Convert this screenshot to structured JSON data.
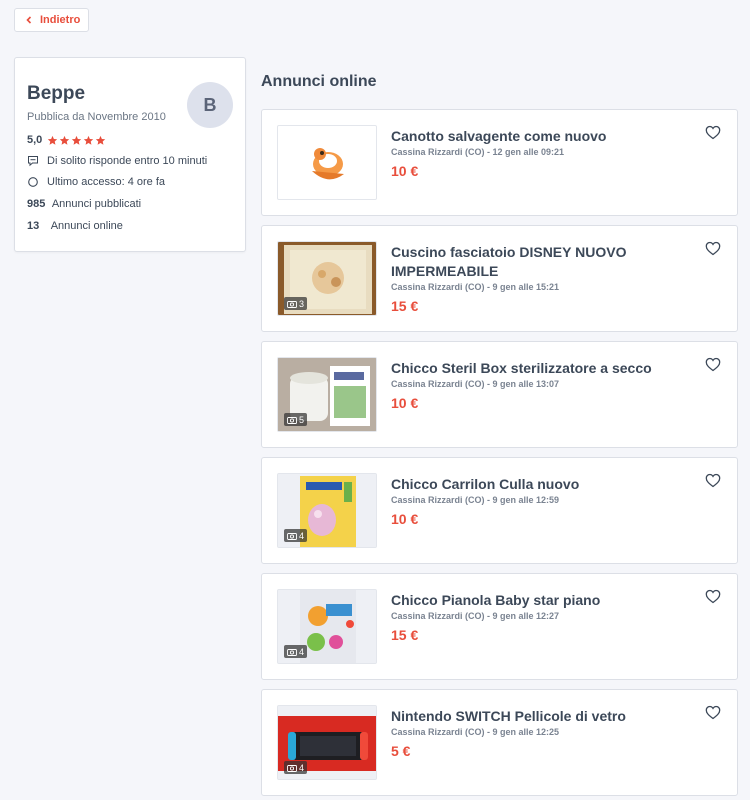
{
  "back": {
    "label": "Indietro"
  },
  "profile": {
    "name": "Beppe",
    "since": "Pubblica da Novembre 2010",
    "avatar_letter": "B",
    "rating": "5,0",
    "response": "Di solito risponde entro 10 minuti",
    "last_access": "Ultimo accesso: 4 ore fa",
    "published_count": "985",
    "published_label": "Annunci pubblicati",
    "online_count": "13",
    "online_label": "Annunci online"
  },
  "section_title": "Annunci online",
  "listings": [
    {
      "title": "Canotto salvagente come nuovo",
      "meta": "Cassina Rizzardi (CO) - 12 gen alle 09:21",
      "price": "10 €",
      "photos": ""
    },
    {
      "title": "Cuscino fasciatoio DISNEY NUOVO IMPERMEABILE",
      "meta": "Cassina Rizzardi (CO) - 9 gen alle 15:21",
      "price": "15 €",
      "photos": "3"
    },
    {
      "title": "Chicco Steril Box sterilizzatore a secco",
      "meta": "Cassina Rizzardi (CO) - 9 gen alle 13:07",
      "price": "10 €",
      "photos": "5"
    },
    {
      "title": "Chicco Carrilon Culla nuovo",
      "meta": "Cassina Rizzardi (CO) - 9 gen alle 12:59",
      "price": "10 €",
      "photos": "4"
    },
    {
      "title": "Chicco Pianola Baby star piano",
      "meta": "Cassina Rizzardi (CO) - 9 gen alle 12:27",
      "price": "15 €",
      "photos": "4"
    },
    {
      "title": "Nintendo SWITCH Pellicole di vetro",
      "meta": "Cassina Rizzardi (CO) - 9 gen alle 12:25",
      "price": "5 €",
      "photos": "4"
    }
  ],
  "colors": {
    "accent": "#e84e3c",
    "text": "#3c4858",
    "muted": "#7a8391",
    "star": "#e84e3c"
  },
  "icons": {
    "back": "chevron-left-icon",
    "favorite": "heart-outline-icon",
    "photos": "camera-icon",
    "response": "chat-bubble-icon",
    "last_access": "clock-circle-icon",
    "rating": "star-icon"
  }
}
